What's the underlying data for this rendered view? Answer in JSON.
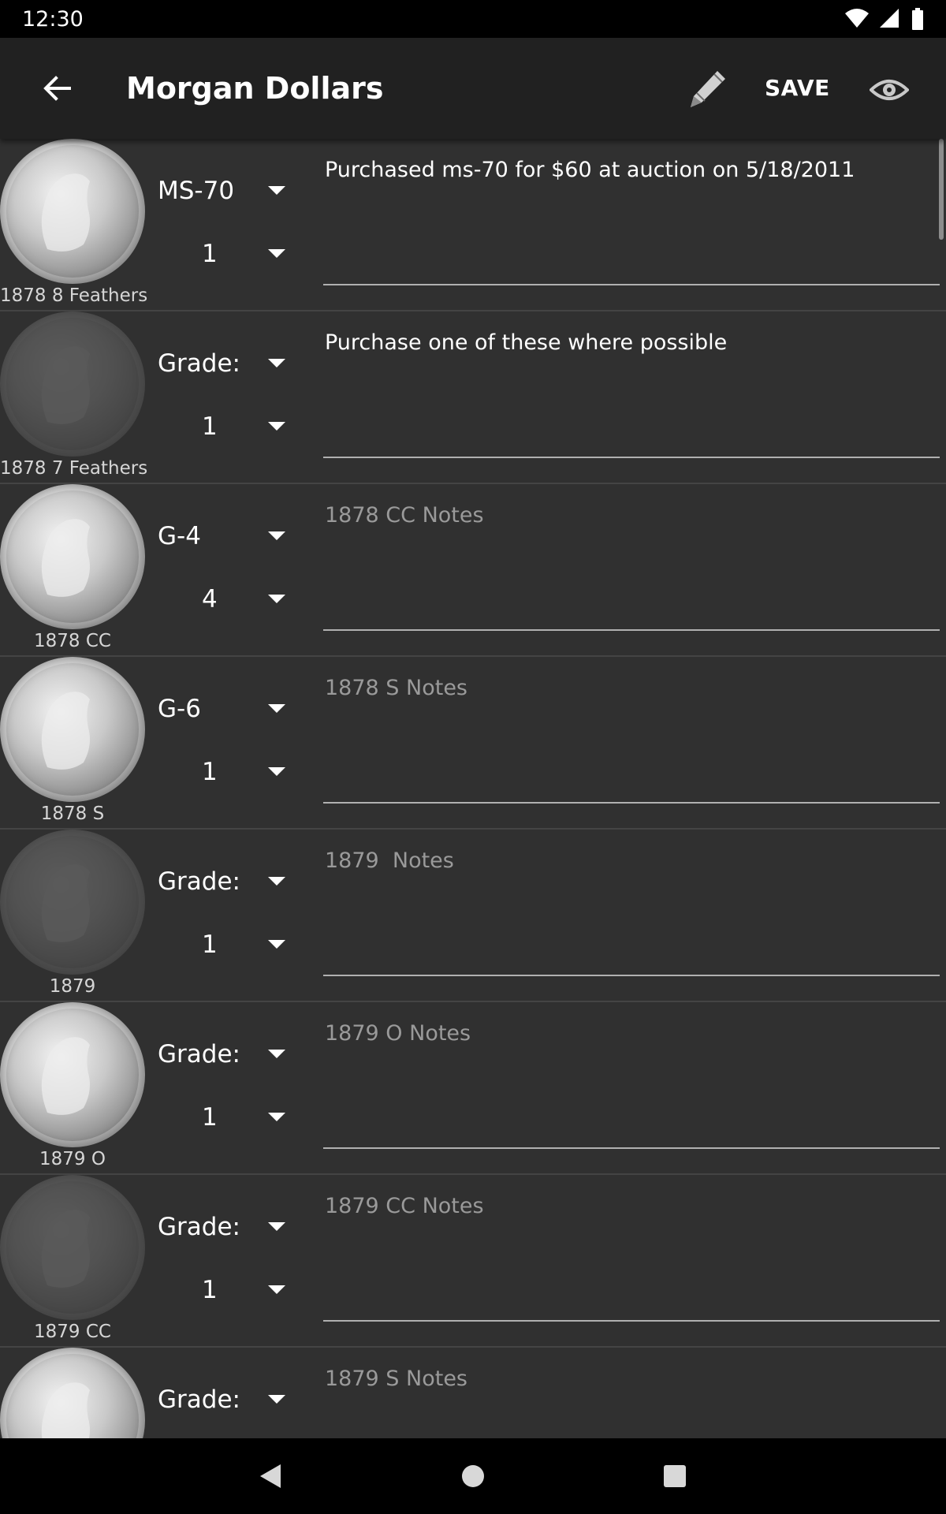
{
  "status_bar": {
    "time": "12:30"
  },
  "app_bar": {
    "title": "Morgan Dollars",
    "save_label": "SAVE",
    "icons": [
      "back-arrow-icon",
      "pencil-icon",
      "eye-icon"
    ]
  },
  "colors": {
    "background": "#303030",
    "app_bar": "#212121",
    "placeholder": "#9a9a9a"
  },
  "coins": [
    {
      "label": "1878 8 Feathers",
      "grade": "MS-70",
      "quantity": "1",
      "notes": "Purchased ms-70 for $60 at auction on 5/18/2011",
      "notes_placeholder": "",
      "owned": true
    },
    {
      "label": "1878 7 Feathers",
      "grade": "Grade:",
      "quantity": "1",
      "notes": "Purchase one of these where possible",
      "notes_placeholder": "",
      "owned": false
    },
    {
      "label": "1878 CC",
      "grade": "G-4",
      "quantity": "4",
      "notes": "",
      "notes_placeholder": "1878 CC Notes",
      "owned": true
    },
    {
      "label": "1878 S",
      "grade": "G-6",
      "quantity": "1",
      "notes": "",
      "notes_placeholder": "1878 S Notes",
      "owned": true
    },
    {
      "label": "1879",
      "grade": "Grade:",
      "quantity": "1",
      "notes": "",
      "notes_placeholder": "1879  Notes",
      "owned": false
    },
    {
      "label": "1879 O",
      "grade": "Grade:",
      "quantity": "1",
      "notes": "",
      "notes_placeholder": "1879 O Notes",
      "owned": true
    },
    {
      "label": "1879 CC",
      "grade": "Grade:",
      "quantity": "1",
      "notes": "",
      "notes_placeholder": "1879 CC Notes",
      "owned": false
    },
    {
      "label": "",
      "grade": "Grade:",
      "quantity": "",
      "notes": "",
      "notes_placeholder": "1879 S Notes",
      "owned": true
    }
  ]
}
